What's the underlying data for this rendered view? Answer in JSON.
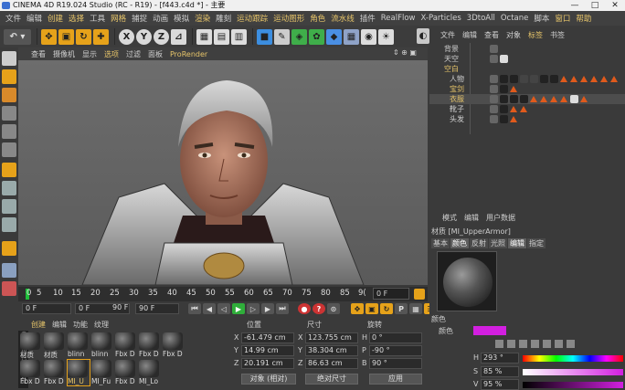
{
  "window": {
    "title": "CINEMA 4D R19.024 Studio (RC - R19) - [f443.c4d *] - 主要",
    "controls": [
      "—",
      "□",
      "✕"
    ]
  },
  "menubar": [
    "文件",
    "编辑",
    "创建",
    "选择",
    "工具",
    "网格",
    "捕捉",
    "动画",
    "模拟",
    "渲染",
    "雕刻",
    "运动跟踪",
    "运动图形",
    "角色",
    "流水线",
    "插件",
    "RealFlow",
    "X-Particles",
    "3DtoAll",
    "Octane",
    "脚本",
    "窗口",
    "帮助"
  ],
  "toolbar": {
    "x": "X",
    "y": "Y",
    "z": "Z"
  },
  "viewport_menu": {
    "items": [
      "查看",
      "摄像机",
      "显示",
      "选项",
      "过滤",
      "面板",
      "ProRender"
    ],
    "active": "选项",
    "nav": "⇕ ⊕ ▣"
  },
  "timeline": {
    "ticks": [
      "0",
      "5",
      "10",
      "15",
      "20",
      "25",
      "30",
      "35",
      "40",
      "45",
      "50",
      "55",
      "60",
      "65",
      "70",
      "75",
      "80",
      "85",
      "9("
    ],
    "frame": "0 F"
  },
  "transport": {
    "start": "0 F",
    "current": "0 F",
    "end_field": "90 F",
    "end": "90 F"
  },
  "materials": {
    "tabs": [
      "创建",
      "编辑",
      "功能",
      "纹理"
    ],
    "row1": [
      "材质",
      "材质",
      "blinn",
      "blinn",
      "Fbx D",
      "Fbx D",
      "Fbx D"
    ],
    "row2": [
      "Fbx D",
      "Fbx D",
      "MI_U",
      "MI_Fu",
      "Fbx D",
      "MI_Lo"
    ],
    "brand": "MAXON CINEMA 4D"
  },
  "coords": {
    "headers": {
      "pos": "位置",
      "size": "尺寸",
      "rot": "旋转"
    },
    "rows": [
      {
        "axis": "X",
        "pos": "-61.479 cm",
        "saxis": "X",
        "size": "123.755 cm",
        "raxis": "H",
        "rot": "0 °"
      },
      {
        "axis": "Y",
        "pos": "14.99 cm",
        "saxis": "Y",
        "size": "38.304 cm",
        "raxis": "P",
        "rot": "-90 °"
      },
      {
        "axis": "Z",
        "pos": "20.191 cm",
        "saxis": "Z",
        "size": "86.63 cm",
        "raxis": "B",
        "rot": "90 °"
      }
    ],
    "mode": "对象 (相对)",
    "size_mode": "绝对尺寸",
    "apply": "应用"
  },
  "objects": {
    "menu": [
      "文件",
      "编辑",
      "查看",
      "对象",
      "标签",
      "书签"
    ],
    "active_menu": "标签",
    "items": [
      {
        "name": "背景",
        "color": "#cfcfcf"
      },
      {
        "name": "天空",
        "color": "#cfcfcf"
      },
      {
        "name": "空白",
        "color": "#e7c56a"
      },
      {
        "name": "人物",
        "color": "#cfcfcf"
      },
      {
        "name": "宝剑",
        "color": "#e7c56a"
      },
      {
        "name": "衣服",
        "color": "#e7c56a"
      },
      {
        "name": "靴子",
        "color": "#cfcfcf"
      },
      {
        "name": "头发",
        "color": "#cfcfcf"
      }
    ]
  },
  "attributes": {
    "menu": [
      "模式",
      "编辑",
      "用户数据"
    ],
    "subtitle": "材质 [MI_UpperArmor]",
    "tabs": [
      "基本",
      "颜色",
      "反射",
      "光照",
      "编辑",
      "指定"
    ],
    "active_tab": "颜色",
    "section": "颜色",
    "color_label": "颜色",
    "swatch": "#d21fe0",
    "h": {
      "label": "H",
      "value": "293 °"
    },
    "s": {
      "label": "S",
      "value": "85 %"
    },
    "v": {
      "label": "V",
      "value": "95 %"
    }
  }
}
